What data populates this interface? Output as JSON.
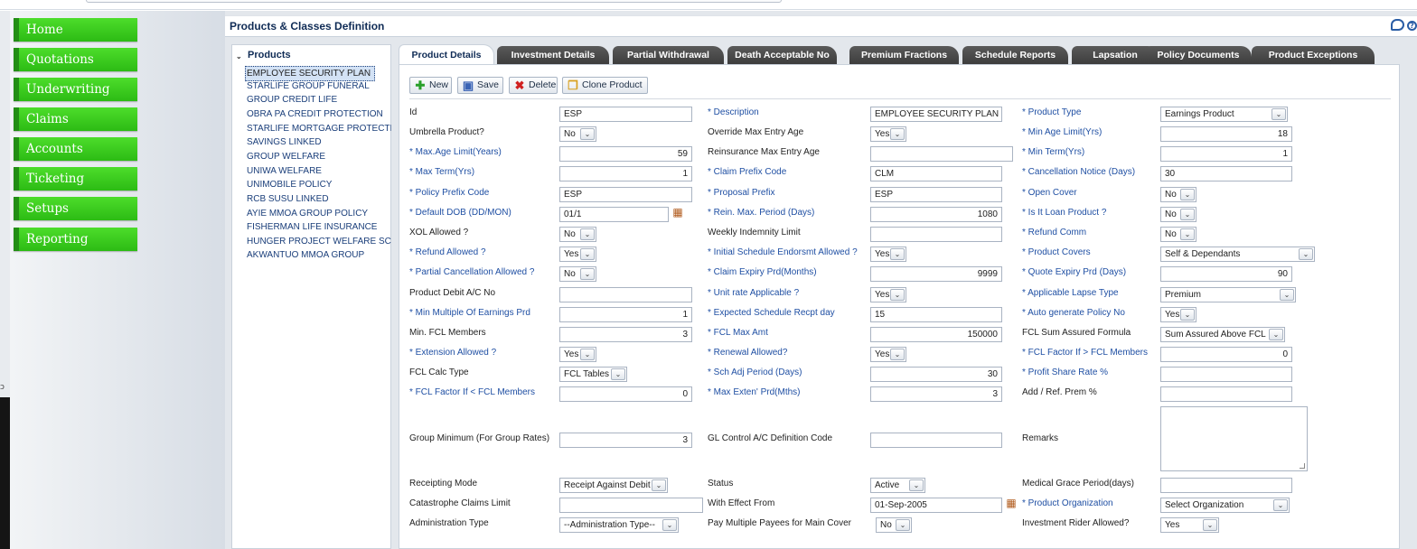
{
  "page_title": "Products & Classes Definition",
  "sidebar": {
    "items": [
      {
        "label": "Home",
        "name": "home"
      },
      {
        "label": "Quotations",
        "name": "quotations"
      },
      {
        "label": "Underwriting",
        "name": "underwriting"
      },
      {
        "label": "Claims",
        "name": "claims"
      },
      {
        "label": "Accounts",
        "name": "accounts"
      },
      {
        "label": "Ticketing",
        "name": "ticketing"
      },
      {
        "label": "Setups",
        "name": "setups"
      },
      {
        "label": "Reporting",
        "name": "reporting"
      }
    ]
  },
  "tree": {
    "header": "Products",
    "items": [
      "EMPLOYEE SECURITY PLAN",
      "STARLIFE GROUP FUNERAL",
      "GROUP CREDIT LIFE",
      "OBRA PA CREDIT PROTECTION",
      "STARLIFE MORTGAGE PROTECTI",
      "SAVINGS LINKED",
      "GROUP WELFARE",
      "UNIWA WELFARE",
      "UNIMOBILE POLICY",
      "RCB SUSU LINKED",
      "AYIE MMOA GROUP POLICY",
      "FISHERMAN LIFE INSURANCE",
      "HUNGER PROJECT WELFARE SCH",
      "AKWANTUO MMOA GROUP"
    ],
    "selected_index": 0
  },
  "tabs": [
    "Product Details",
    "Investment Details",
    "Partial Withdrawal",
    "Death Acceptable No",
    "Premium Fractions",
    "Schedule Reports",
    "Lapsation",
    "Policy Documents",
    "Product Exceptions"
  ],
  "toolbar": {
    "new": "New",
    "save": "Save",
    "delete": "Delete",
    "clone": "Clone Product"
  },
  "form": {
    "id_label": "Id",
    "id_value": "ESP",
    "description_label": "* Description",
    "description_value": "EMPLOYEE SECURITY PLAN",
    "product_type_label": "* Product Type",
    "product_type_value": "Earnings Product",
    "umbrella_label": "Umbrella Product?",
    "umbrella_value": "No",
    "override_max_entry_label": "Override Max Entry Age",
    "override_max_entry_value": "Yes",
    "min_age_limit_label": "* Min Age Limit(Yrs)",
    "min_age_limit_value": "18",
    "max_age_limit_label": "* Max.Age Limit(Years)",
    "max_age_limit_value": "59",
    "reinsurance_max_entry_label": "Reinsurance Max Entry Age",
    "reinsurance_max_entry_value": "",
    "min_term_label": "* Min Term(Yrs)",
    "min_term_value": "1",
    "max_term_label": "* Max Term(Yrs)",
    "max_term_value": "1",
    "claim_prefix_label": "* Claim Prefix Code",
    "claim_prefix_value": "CLM",
    "cancellation_notice_label": "* Cancellation Notice (Days)",
    "cancellation_notice_value": "30",
    "policy_prefix_label": "* Policy Prefix Code",
    "policy_prefix_value": "ESP",
    "proposal_prefix_label": "* Proposal Prefix",
    "proposal_prefix_value": "ESP",
    "open_cover_label": "* Open Cover",
    "open_cover_value": "No",
    "default_dob_label": "* Default DOB (DD/MON)",
    "default_dob_value": "01/1",
    "rein_max_period_label": "* Rein. Max. Period (Days)",
    "rein_max_period_value": "1080",
    "loan_product_label": "* Is It Loan Product ?",
    "loan_product_value": "No",
    "xol_allowed_label": "XOL Allowed ?",
    "xol_allowed_value": "No",
    "weekly_indemnity_label": "Weekly Indemnity Limit",
    "weekly_indemnity_value": "",
    "refund_comm_label": "* Refund Comm",
    "refund_comm_value": "No",
    "refund_allowed_label": "* Refund Allowed ?",
    "refund_allowed_value": "Yes",
    "initial_schedule_label": "* Initial Schedule Endorsmt Allowed ?",
    "initial_schedule_value": "Yes",
    "product_covers_label": "* Product Covers",
    "product_covers_value": "Self & Dependants",
    "partial_cancellation_label": "* Partial Cancellation Allowed ?",
    "partial_cancellation_value": "No",
    "claim_expiry_label": "* Claim Expiry Prd(Months)",
    "claim_expiry_value": "9999",
    "quote_expiry_label": "* Quote Expiry Prd (Days)",
    "quote_expiry_value": "90",
    "product_debit_label": "Product Debit A/C No",
    "product_debit_value": "",
    "unit_rate_label": "* Unit rate Applicable ?",
    "unit_rate_value": "Yes",
    "lapse_type_label": "* Applicable Lapse Type",
    "lapse_type_value": "Premium",
    "min_multiple_label": "* Min Multiple Of Earnings Prd",
    "min_multiple_value": "1",
    "expected_schedule_label": "* Expected Schedule Recpt day",
    "expected_schedule_value": "15",
    "auto_generate_label": "* Auto generate Policy No",
    "auto_generate_value": "Yes",
    "min_fcl_label": "Min. FCL Members",
    "min_fcl_value": "3",
    "fcl_max_amt_label": "* FCL Max Amt",
    "fcl_max_amt_value": "150000",
    "fcl_sum_formula_label": "FCL Sum Assured Formula",
    "fcl_sum_formula_value": "Sum Assured Above FCL",
    "extension_label": "* Extension Allowed ?",
    "extension_value": "Yes",
    "renewal_label": "* Renewal Allowed?",
    "renewal_value": "Yes",
    "fcl_factor_gt_label": "* FCL Factor If > FCL Members",
    "fcl_factor_gt_value": "0",
    "fcl_calc_label": "FCL Calc Type",
    "fcl_calc_value": "FCL Tables",
    "sch_adj_label": "* Sch Adj Period (Days)",
    "sch_adj_value": "30",
    "profit_share_label": "* Profit Share Rate %",
    "profit_share_value": "",
    "fcl_factor_lt_label": "*  FCL Factor If < FCL Members",
    "fcl_factor_lt_value": "0",
    "max_exten_label": "* Max Exten' Prd(Mths)",
    "max_exten_value": "3",
    "add_ref_prem_label": "Add / Ref. Prem %",
    "add_ref_prem_value": "",
    "group_minimum_label": "Group Minimum (For Group Rates)",
    "group_minimum_value": "3",
    "gl_control_label": "GL Control A/C Definition Code",
    "gl_control_value": "",
    "remarks_label": "Remarks",
    "remarks_value": "",
    "receipting_mode_label": "Receipting Mode",
    "receipting_mode_value": "Receipt Against Debit",
    "status_label": "Status",
    "status_value": "Active",
    "medical_grace_label": "Medical Grace Period(days)",
    "medical_grace_value": "",
    "catastrophe_label": "Catastrophe Claims Limit",
    "catastrophe_value": "",
    "with_effect_label": "With Effect From",
    "with_effect_value": "01-Sep-2005",
    "product_org_label": "* Product Organization",
    "product_org_value": "Select Organization",
    "admin_type_label": "Administration Type",
    "admin_type_value": "--Administration Type--",
    "pay_multiple_label": "Pay Multiple Payees for Main Cover",
    "pay_multiple_value": "No",
    "investment_rider_label": "Investment Rider Allowed?",
    "investment_rider_value": "Yes"
  }
}
